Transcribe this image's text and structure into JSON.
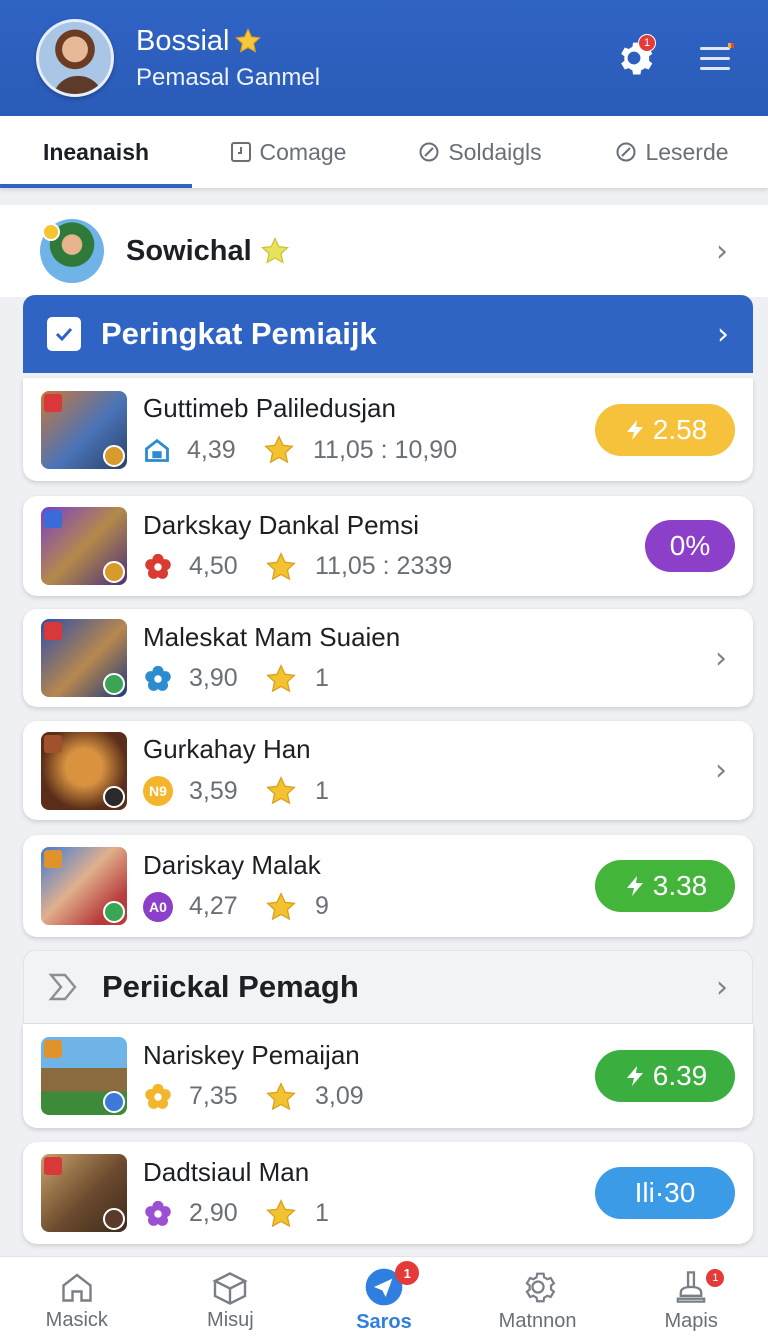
{
  "header": {
    "name": "Bossial",
    "subtitle": "Pemasal Ganmel",
    "settings_badge": "1"
  },
  "tabs": [
    {
      "label": "Ineanaish",
      "active": true
    },
    {
      "label": "Comage",
      "active": false
    },
    {
      "label": "Soldaigls",
      "active": false
    },
    {
      "label": "Leserde",
      "active": false
    }
  ],
  "featured": {
    "title": "Sowichal"
  },
  "section1": {
    "title": "Peringkat Pemiaijk"
  },
  "section2": {
    "title": "Periickal Pemagh"
  },
  "items": [
    {
      "title": "Guttimeb Paliledusjan",
      "rating": "4,39",
      "value": "11,05 : 10,90",
      "pill": "2.58",
      "pill_color": "#f6c23b"
    },
    {
      "title": "Darkskay Dankal Pemsi",
      "rating": "4,50",
      "value": "11,05 : 2339",
      "pill": "0%",
      "pill_color": "#8c3fc9"
    },
    {
      "title": "Maleskat Mam Suaien",
      "rating": "3,90",
      "value": "1"
    },
    {
      "title": "Gurkahay Han",
      "rating": "3,59",
      "value": "1",
      "badge": "N9"
    },
    {
      "title": "Dariskay Malak",
      "rating": "4,27",
      "value": "9",
      "badge": "A0",
      "pill": "3.38",
      "pill_color": "#43b53a"
    },
    {
      "title": "Nariskey Pemaijan",
      "rating": "7,35",
      "value": "3,09",
      "pill": "6.39",
      "pill_color": "#3aae3f"
    },
    {
      "title": "Dadtsiaul Man",
      "rating": "2,90",
      "value": "1",
      "pill": "Ili·30",
      "pill_color": "#3b9be6"
    }
  ],
  "bottom_nav": [
    {
      "label": "Masick",
      "active": false
    },
    {
      "label": "Misuj",
      "active": false
    },
    {
      "label": "Saros",
      "active": true,
      "badge": "1"
    },
    {
      "label": "Matnnon",
      "active": false
    },
    {
      "label": "Mapis",
      "active": false,
      "badge": "1"
    }
  ]
}
